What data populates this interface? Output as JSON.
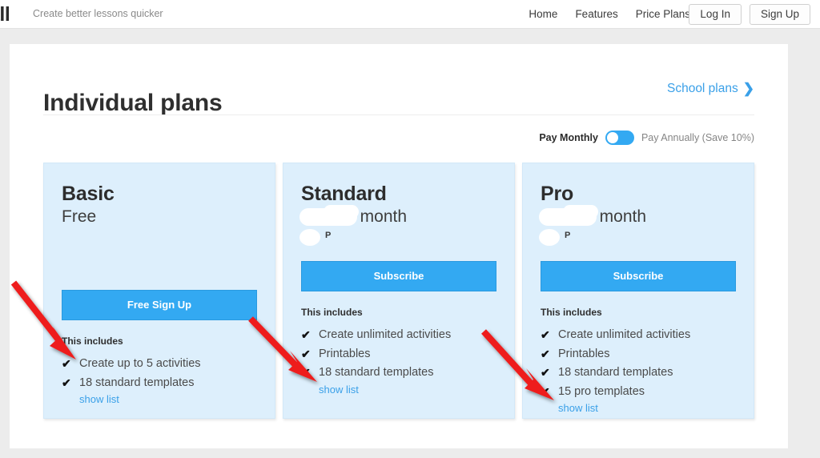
{
  "header": {
    "logo_text": "all",
    "tagline": "Create better lessons quicker",
    "nav_links": [
      {
        "label": "Home"
      },
      {
        "label": "Features"
      },
      {
        "label": "Price Plans"
      }
    ],
    "login_label": "Log In",
    "signup_label": "Sign Up"
  },
  "page": {
    "title": "Individual plans",
    "school_link_label": "School plans",
    "school_link_chevron": "chevron-right-icon"
  },
  "billing": {
    "monthly_label": "Pay Monthly",
    "annual_label": "Pay Annually (Save 10%)",
    "toggle_state": "monthly",
    "toggle_accent": "#33a9f2"
  },
  "plans": [
    {
      "name": "Basic",
      "price": "Free",
      "price_redacted": false,
      "sub_note": "",
      "sub_redacted": false,
      "cta_label": "Free Sign Up",
      "includes_label": "This includes",
      "features": [
        "Create up to 5 activities",
        "18 standard templates"
      ],
      "show_list_label": "show list"
    },
    {
      "name": "Standard",
      "price": "/ month",
      "price_redacted": true,
      "sub_note": "P",
      "sub_redacted": true,
      "cta_label": "Subscribe",
      "includes_label": "This includes",
      "features": [
        "Create unlimited activities",
        "Printables",
        "18 standard templates"
      ],
      "show_list_label": "show list"
    },
    {
      "name": "Pro",
      "price": "/ month",
      "price_redacted": true,
      "sub_note": "P",
      "sub_redacted": true,
      "cta_label": "Subscribe",
      "includes_label": "This includes",
      "features": [
        "Create unlimited activities",
        "Printables",
        "18 standard templates",
        "15 pro templates"
      ],
      "show_list_label": "show list"
    }
  ],
  "annotations": {
    "color": "#ee1c1c",
    "arrows": [
      {
        "target": "basic-show-list"
      },
      {
        "target": "standard-show-list"
      },
      {
        "target": "pro-show-list"
      }
    ]
  }
}
